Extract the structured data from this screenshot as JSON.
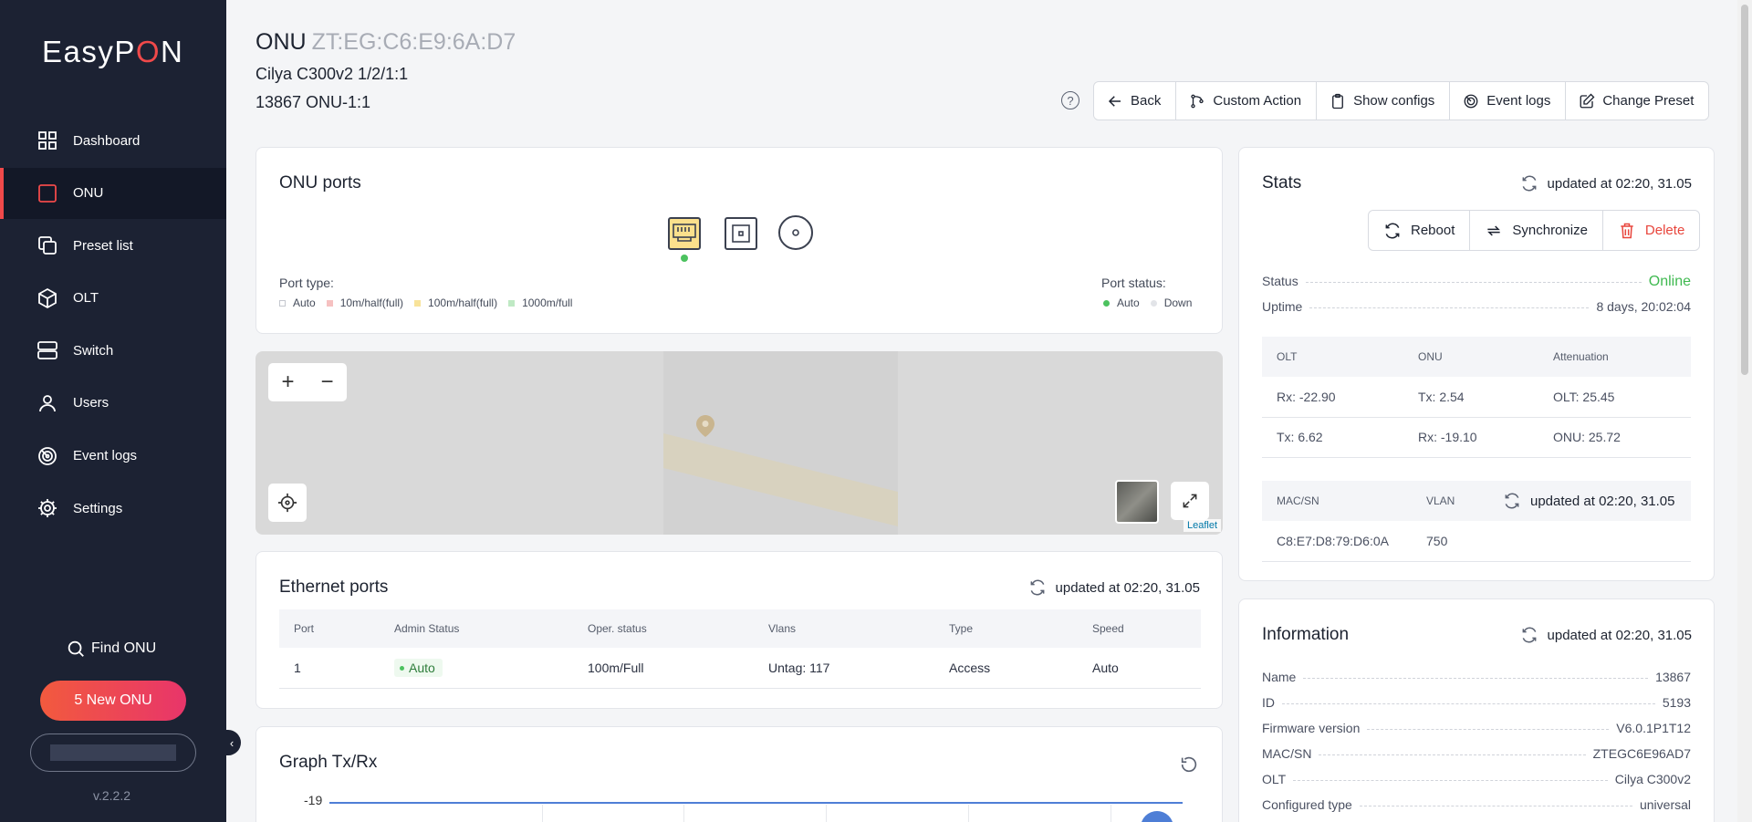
{
  "app": {
    "logo_part1": "EasyP",
    "logo_accent": "O",
    "logo_part2": "N",
    "version": "v.2.2.2"
  },
  "sidebar": {
    "items": [
      {
        "label": "Dashboard",
        "icon": "dashboard-icon"
      },
      {
        "label": "ONU",
        "icon": "onu-icon",
        "active": true
      },
      {
        "label": "Preset list",
        "icon": "copy-icon"
      },
      {
        "label": "OLT",
        "icon": "cube-icon"
      },
      {
        "label": "Switch",
        "icon": "server-icon"
      },
      {
        "label": "Users",
        "icon": "user-icon"
      },
      {
        "label": "Event logs",
        "icon": "radar-icon"
      },
      {
        "label": "Settings",
        "icon": "gear-icon"
      }
    ],
    "find_onu": "Find ONU",
    "new_onu": "5 New ONU"
  },
  "header": {
    "title": "ONU",
    "mac": "ZT:EG:C6:E9:6A:D7",
    "subtitle1": "Cilya C300v2 1/2/1:1",
    "subtitle2": "13867 ONU-1:1",
    "toolbar": {
      "back": "Back",
      "custom_action": "Custom Action",
      "show_configs": "Show configs",
      "event_logs": "Event logs",
      "change_preset": "Change Preset"
    }
  },
  "onu_ports": {
    "title": "ONU ports",
    "port_type_label": "Port type:",
    "port_types": [
      {
        "label": "Auto",
        "color": "#ffffff"
      },
      {
        "label": "10m/half(full)",
        "color": "#f6c1c1"
      },
      {
        "label": "100m/half(full)",
        "color": "#f8e39a"
      },
      {
        "label": "1000m/full",
        "color": "#bfe9c4"
      }
    ],
    "port_status_label": "Port status:",
    "port_statuses": [
      {
        "label": "Auto",
        "color": "#4cc25f"
      },
      {
        "label": "Down",
        "color": "#e2e4e8"
      }
    ]
  },
  "map": {
    "attribution": "Leaflet",
    "zoom_in": "+",
    "zoom_out": "−"
  },
  "ethernet": {
    "title": "Ethernet ports",
    "updated": "updated at 02:20, 31.05",
    "columns": [
      "Port",
      "Admin Status",
      "Oper. status",
      "Vlans",
      "Type",
      "Speed"
    ],
    "rows": [
      {
        "port": "1",
        "admin": "Auto",
        "oper": "100m/Full",
        "vlans": "Untag: 117",
        "type": "Access",
        "speed": "Auto"
      }
    ]
  },
  "graph": {
    "title": "Graph Tx/Rx",
    "y_tick": "-19"
  },
  "stats": {
    "title": "Stats",
    "updated": "updated at 02:20, 31.05",
    "reboot": "Reboot",
    "synchronize": "Synchronize",
    "delete": "Delete",
    "status_label": "Status",
    "status_value": "Online",
    "uptime_label": "Uptime",
    "uptime_value": "8 days, 20:02:04",
    "signal_columns": [
      "OLT",
      "ONU",
      "Attenuation"
    ],
    "signal_rows": [
      [
        "Rx: -22.90",
        "Tx: 2.54",
        "OLT: 25.45"
      ],
      [
        "Tx: 6.62",
        "Rx: -19.10",
        "ONU: 25.72"
      ]
    ],
    "mac_columns": [
      "MAC/SN",
      "VLAN"
    ],
    "mac_updated": "updated at 02:20, 31.05",
    "mac_rows": [
      [
        "C8:E7:D8:79:D6:0A",
        "750"
      ]
    ]
  },
  "information": {
    "title": "Information",
    "updated": "updated at 02:20, 31.05",
    "fields": [
      {
        "label": "Name",
        "value": "13867"
      },
      {
        "label": "ID",
        "value": "5193"
      },
      {
        "label": "Firmware version",
        "value": "V6.0.1P1T12"
      },
      {
        "label": "MAC/SN",
        "value": "ZTEGC6E96AD7"
      },
      {
        "label": "OLT",
        "value": "Cilya C300v2"
      },
      {
        "label": "Configured type",
        "value": "universal"
      }
    ]
  }
}
